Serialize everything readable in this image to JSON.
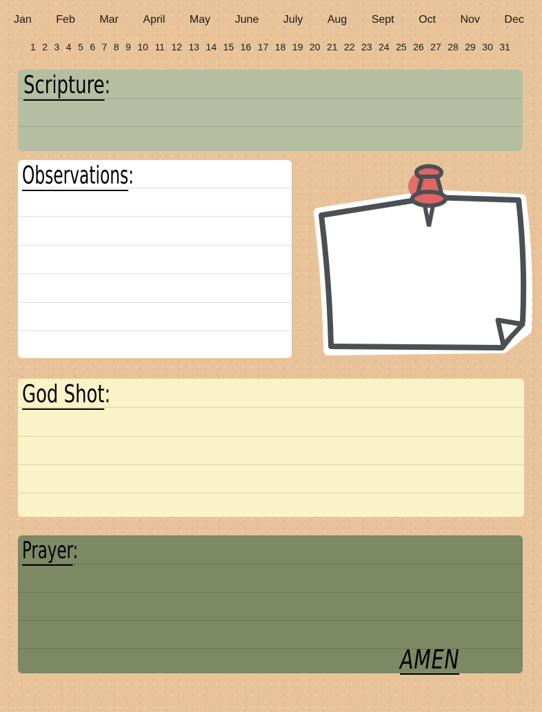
{
  "months": [
    "Jan",
    "Feb",
    "Mar",
    "April",
    "May",
    "June",
    "July",
    "Aug",
    "Sept",
    "Oct",
    "Nov",
    "Dec"
  ],
  "days": [
    "1",
    "2",
    "3",
    "4",
    "5",
    "6",
    "7",
    "8",
    "9",
    "10",
    "11",
    "12",
    "13",
    "14",
    "15",
    "16",
    "17",
    "18",
    "19",
    "20",
    "21",
    "22",
    "23",
    "24",
    "25",
    "26",
    "27",
    "28",
    "29",
    "30",
    "31"
  ],
  "sections": {
    "scripture": {
      "title": "Scripture",
      "colon": ":",
      "color": "#b6bea2"
    },
    "observations": {
      "title": "Observations",
      "colon": ":",
      "color": "#ffffff"
    },
    "godshot": {
      "title": "God Shot",
      "colon": ":",
      "color": "#fbf3c8"
    },
    "prayer": {
      "title": "Prayer",
      "colon": ":",
      "color": "#7d8865",
      "closing": "AMEN"
    }
  },
  "note": {
    "icon": "pinned-note-icon",
    "pin_color": "#e06565",
    "outline_color": "#4a5053"
  }
}
